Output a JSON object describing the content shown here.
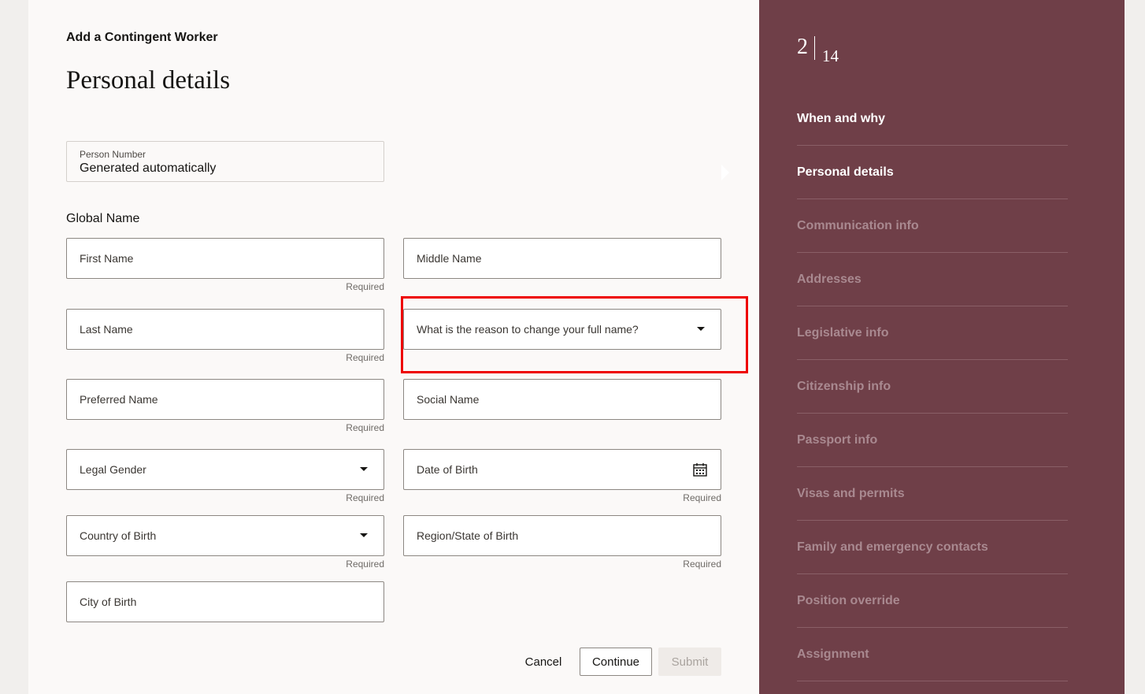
{
  "header": {
    "eyebrow": "Add a Contingent Worker",
    "title": "Personal details"
  },
  "person_number": {
    "label": "Person Number",
    "value": "Generated automatically"
  },
  "global_name": {
    "section_label": "Global Name"
  },
  "fields": {
    "first_name": {
      "label": "First Name",
      "hint": "Required"
    },
    "middle_name": {
      "label": "Middle Name"
    },
    "last_name": {
      "label": "Last Name",
      "hint": "Required"
    },
    "name_change_reason": {
      "label": "What is the reason to change your full name?"
    },
    "preferred_name": {
      "label": "Preferred Name",
      "hint": "Required"
    },
    "social_name": {
      "label": "Social Name"
    },
    "legal_gender": {
      "label": "Legal Gender",
      "hint": "Required"
    },
    "date_of_birth": {
      "label": "Date of Birth",
      "hint": "Required"
    },
    "country_of_birth": {
      "label": "Country of Birth",
      "hint": "Required"
    },
    "region_of_birth": {
      "label": "Region/State of Birth",
      "hint": "Required"
    },
    "city_of_birth": {
      "label": "City of Birth"
    }
  },
  "actions": {
    "cancel": "Cancel",
    "continue": "Continue",
    "submit": "Submit"
  },
  "sidebar": {
    "current_step": "2",
    "total_steps": "14",
    "steps": [
      {
        "label": "When and why",
        "state": "done"
      },
      {
        "label": "Personal details",
        "state": "current"
      },
      {
        "label": "Communication info",
        "state": "pending"
      },
      {
        "label": "Addresses",
        "state": "pending"
      },
      {
        "label": "Legislative info",
        "state": "pending"
      },
      {
        "label": "Citizenship info",
        "state": "pending"
      },
      {
        "label": "Passport info",
        "state": "pending"
      },
      {
        "label": "Visas and permits",
        "state": "pending"
      },
      {
        "label": "Family and emergency contacts",
        "state": "pending"
      },
      {
        "label": "Position override",
        "state": "pending"
      },
      {
        "label": "Assignment",
        "state": "pending"
      }
    ]
  },
  "icons": {
    "dropdown": "chevron-down-icon",
    "calendar": "calendar-icon"
  },
  "colors": {
    "sidebar_bg": "#6f3f48",
    "highlight": "#ee0000",
    "page_bg": "#fbf9f8"
  }
}
